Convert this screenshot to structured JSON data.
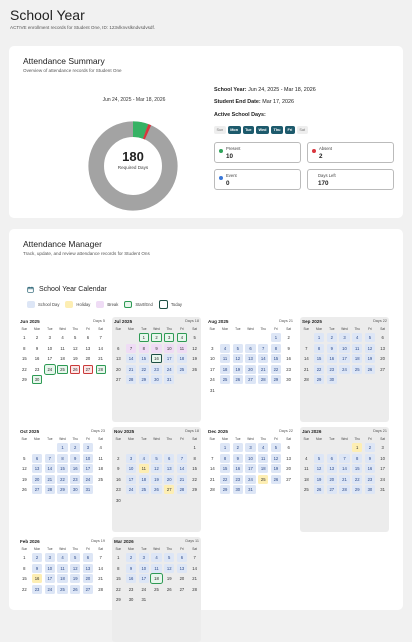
{
  "page": {
    "title": "School Year",
    "subtitle": "ACTIVE enrollment records for Student One, ID: 123vlknvslkndvsdvsdf."
  },
  "summary": {
    "title": "Attendance Summary",
    "subtitle": "Overview of attendance records for Student One",
    "range": "Jun 24, 2025 - Mar 18, 2026",
    "donut_value": "180",
    "donut_label": "Required Days",
    "donut_total": 180,
    "donut_present": 10,
    "donut_absent": 2,
    "school_year_label": "School Year:",
    "school_year_value": "Jun 24, 2025 - Mar 18, 2026",
    "end_label": "Student End Date:",
    "end_value": "Mar 17, 2026",
    "active_days_label": "Active School Days:",
    "days": [
      {
        "label": "Sun",
        "active": false
      },
      {
        "label": "Mon",
        "active": true
      },
      {
        "label": "Tue",
        "active": true
      },
      {
        "label": "Wed",
        "active": true
      },
      {
        "label": "Thu",
        "active": true
      },
      {
        "label": "Fri",
        "active": true
      },
      {
        "label": "Sat",
        "active": false
      }
    ],
    "stats": {
      "present": {
        "label": "Present",
        "value": "10",
        "color": "#2fa35a"
      },
      "absent": {
        "label": "Absent",
        "value": "2",
        "color": "#d9363e"
      },
      "event": {
        "label": "Event",
        "value": "0",
        "color": "#3b78d8"
      },
      "days_left": {
        "label": "Days Left",
        "value": "170"
      }
    },
    "colors": {
      "ring": "#a3a3a3",
      "present": "#36b264",
      "absent": "#d9363e"
    }
  },
  "manager": {
    "title": "Attendance Manager",
    "subtitle": "Track, update, and review attendance records for Student Ons",
    "calendar_title": "School Year Calendar",
    "legend": {
      "school": "School Day",
      "holiday": "Holiday",
      "break": "Break",
      "startend": "Start/End",
      "today": "Today"
    },
    "dow": [
      "Sun",
      "Mon",
      "Tue",
      "Wed",
      "Thu",
      "Fri",
      "Sat"
    ],
    "months": [
      {
        "name": "Jun 2025",
        "days_label": "Days 5",
        "alt": false
      },
      {
        "name": "Jul 2025",
        "days_label": "Days 18",
        "alt": true
      },
      {
        "name": "Aug 2025",
        "days_label": "Days 21",
        "alt": false
      },
      {
        "name": "Sep 2025",
        "days_label": "Days 22",
        "alt": true
      },
      {
        "name": "Oct 2025",
        "days_label": "Days 23",
        "alt": false
      },
      {
        "name": "Nov 2025",
        "days_label": "Days 18",
        "alt": true
      },
      {
        "name": "Dec 2025",
        "days_label": "Days 22",
        "alt": false
      },
      {
        "name": "Jan 2026",
        "days_label": "Days 21",
        "alt": true
      },
      {
        "name": "Feb 2026",
        "days_label": "Days 19",
        "alt": false
      },
      {
        "name": "Mar 2026",
        "days_label": "Days 11",
        "alt": true
      }
    ]
  }
}
